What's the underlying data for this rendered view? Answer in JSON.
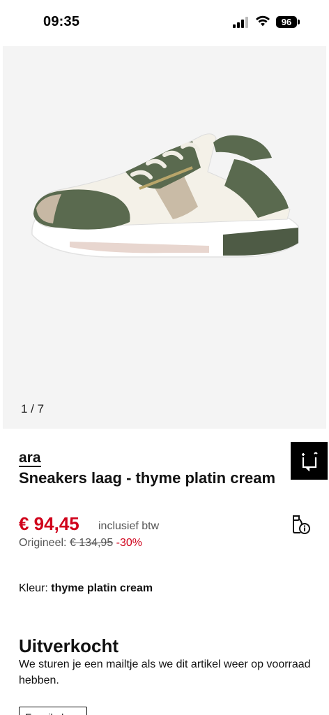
{
  "status_bar": {
    "time": "09:35",
    "battery": "96",
    "icons": [
      "signal-icon",
      "wifi-icon",
      "battery-icon"
    ]
  },
  "gallery": {
    "counter": "1 / 7",
    "image": "sneaker-image"
  },
  "product": {
    "brand": "ara",
    "title": "Sneakers laag - thyme platin cream",
    "price": "€ 94,45",
    "vat_note": "inclusief btw",
    "original_label": "Origineel:",
    "original_price": "€ 134,95",
    "discount": "-30%"
  },
  "color": {
    "label": "Kleur:",
    "value": "thyme platin cream"
  },
  "availability": {
    "heading": "Uitverkocht",
    "message": "We sturen je een mailtje als we dit artikel weer op voorraad hebben.",
    "email_placeholder": "E-mailadres"
  },
  "colors": {
    "accent_red": "#d0021b",
    "black": "#000000",
    "gallery_bg": "#f4f4f4"
  }
}
